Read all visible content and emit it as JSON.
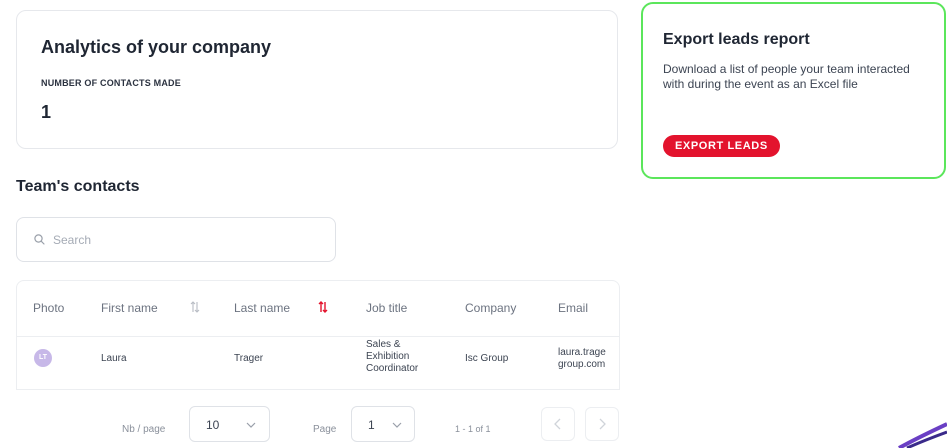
{
  "analytics": {
    "title": "Analytics of your company",
    "contacts_label": "NUMBER OF CONTACTS MADE",
    "contacts_value": "1"
  },
  "export": {
    "title": "Export leads report",
    "description": "Download a list of people your team interacted with during the event as an Excel file",
    "button_label": "EXPORT LEADS",
    "button_color": "#e3132d",
    "highlight_color": "#5be65b"
  },
  "contacts": {
    "title": "Team's contacts",
    "search_placeholder": "Search",
    "columns": [
      "Photo",
      "First name",
      "Last name",
      "Job title",
      "Company",
      "Email"
    ],
    "rows": [
      {
        "avatar_initials": "LT",
        "first_name": "Laura",
        "last_name": "Trager",
        "job_title": "Sales & Exhibition Coordinator",
        "company": "Isc Group",
        "email": "laura.trage\ngroup.com"
      }
    ]
  },
  "pagination": {
    "per_page_label": "Nb / page",
    "per_page_value": "10",
    "page_label": "Page",
    "page_value": "1",
    "range_text": "1 - 1 of 1"
  }
}
